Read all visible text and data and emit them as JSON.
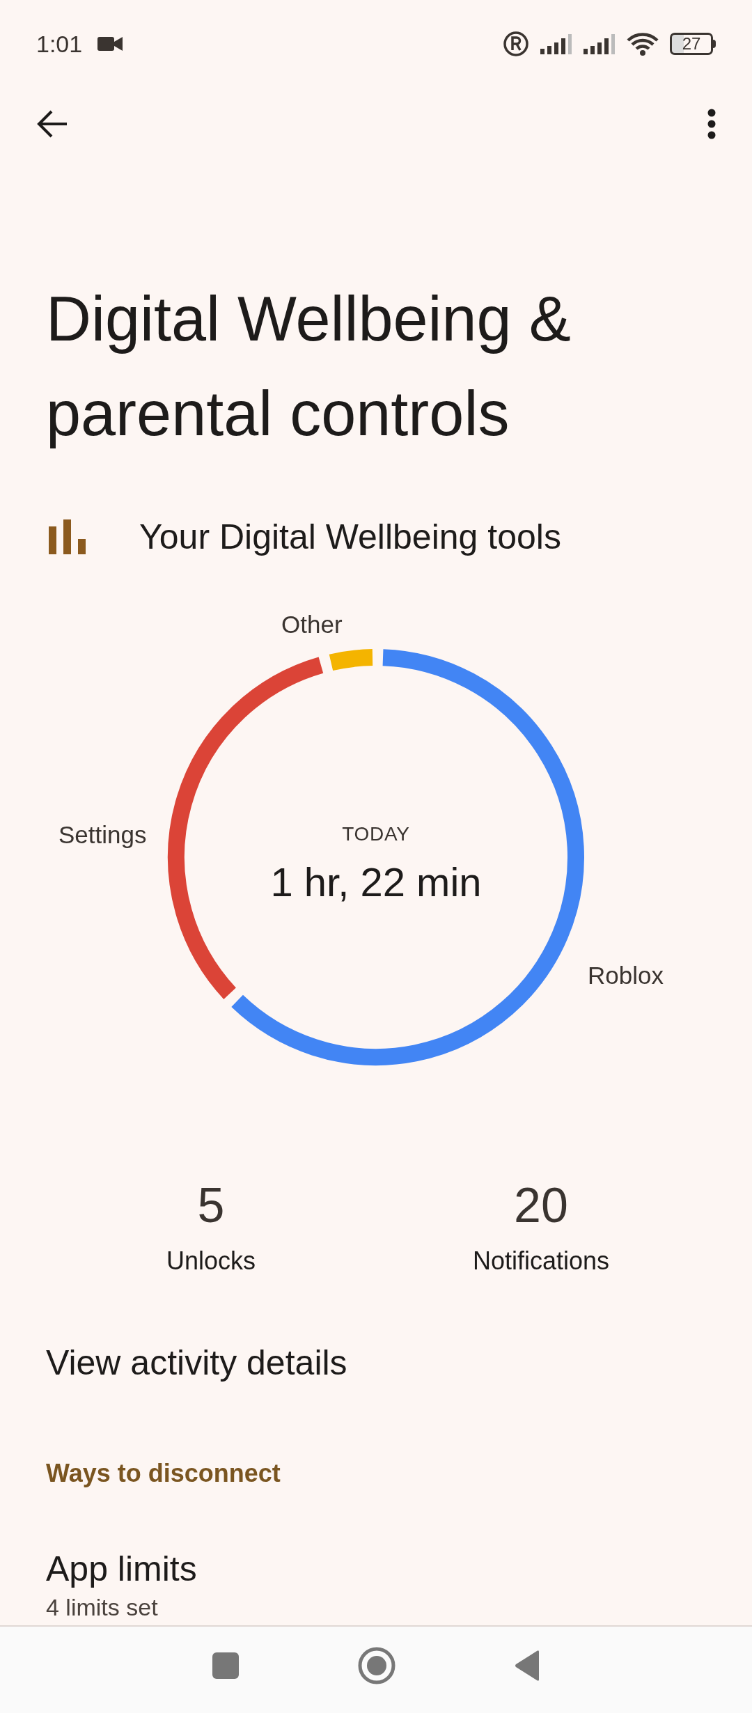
{
  "status_bar": {
    "time": "1:01",
    "battery": "27"
  },
  "title": "Digital Wellbeing & parental controls",
  "tools_header": "Your Digital Wellbeing tools",
  "usage_ring": {
    "caption": "TODAY",
    "total": "1 hr, 22 min",
    "segments": [
      {
        "label": "Other",
        "color": "#f4b400"
      },
      {
        "label": "Settings",
        "color": "#db4437"
      },
      {
        "label": "Roblox",
        "color": "#4285f4"
      }
    ]
  },
  "stats": [
    {
      "value": "5",
      "label": "Unlocks"
    },
    {
      "value": "20",
      "label": "Notifications"
    }
  ],
  "activity_link": "View activity details",
  "section_header": "Ways to disconnect",
  "items": [
    {
      "title": "App limits",
      "subtitle": "4 limits set"
    }
  ]
}
